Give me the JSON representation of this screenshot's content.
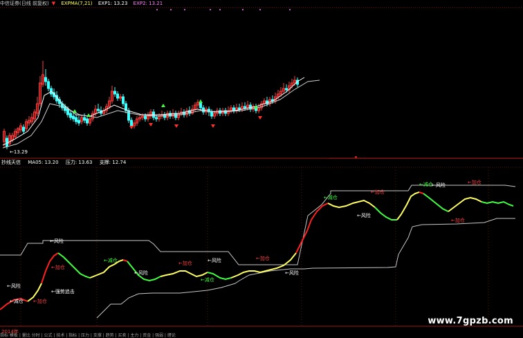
{
  "header": {
    "title": "中信证券(日线 前复权)",
    "ind1": "EXPMA(7,21)",
    "ind2": "EXP1: 13.23",
    "ind3": "EXP2: 13.21"
  },
  "main_chart": {
    "low_label": "13.29"
  },
  "sub_panel": {
    "name": "抄线天信",
    "ma": "MA05: 13.20",
    "pressure": "压力: 13.63",
    "support": "支撑: 12.74"
  },
  "annotations": [
    {
      "text": "←风险",
      "color": "#ffffff"
    },
    {
      "text": "←减仓",
      "color": "#ffffff"
    },
    {
      "text": "←强势追击",
      "color": "#ffffff"
    },
    {
      "text": "←加仓",
      "color": "#ff4040"
    },
    {
      "text": "←风险",
      "color": "#ffffff"
    },
    {
      "text": "←加仓",
      "color": "#ff4040"
    },
    {
      "text": "←减仓",
      "color": "#40ff40"
    },
    {
      "text": "←风险",
      "color": "#ffffff"
    },
    {
      "text": "←加仓",
      "color": "#ff4040"
    },
    {
      "text": "←减仓",
      "color": "#40ff40"
    },
    {
      "text": "←风险",
      "color": "#ffffff"
    },
    {
      "text": "←加仓",
      "color": "#ff4040"
    },
    {
      "text": "←风险",
      "color": "#ffffff"
    },
    {
      "text": "←减仓",
      "color": "#40ff40"
    },
    {
      "text": "←加仓",
      "color": "#ff4040"
    },
    {
      "text": "←风险",
      "color": "#ffffff"
    },
    {
      "text": "←减仓",
      "color": "#40ff40"
    },
    {
      "text": "←加仓",
      "color": "#ff4040"
    },
    {
      "text": "←风险",
      "color": "#ffffff"
    },
    {
      "text": "←加仓",
      "color": "#ff4040"
    }
  ],
  "bottom_bar": {
    "year": "2014年",
    "items": "指标 模板 | 量比 分时 | 公式 | 技术 | 指标 | 压力 | 支撑 | 趋势 | 买卖 | 主力 | 资金 | 强弱 | 缠论"
  },
  "watermark": "www.7gpzb.com"
}
